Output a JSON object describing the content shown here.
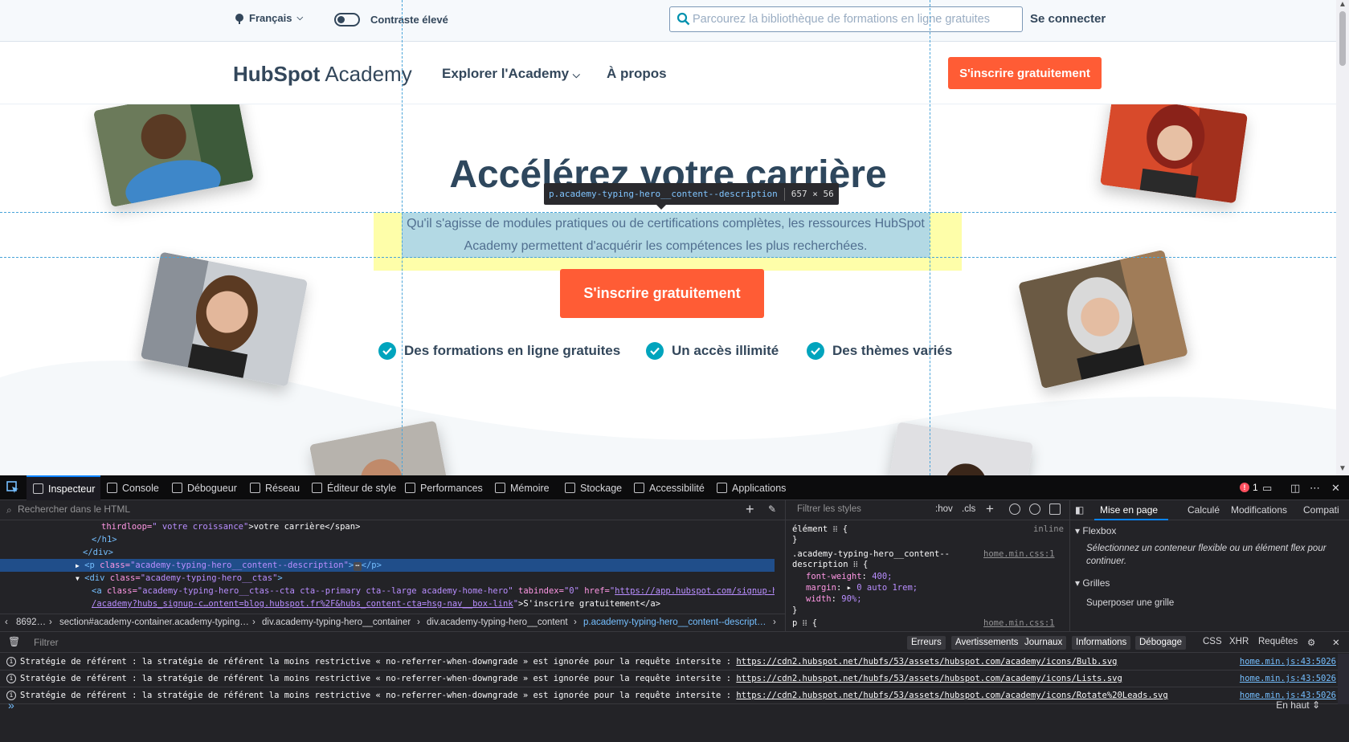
{
  "page": {
    "language": "Français",
    "contrast_label": "Contraste élevé",
    "search_placeholder": "Parcourez la bibliothèque de formations en ligne gratuites",
    "login": "Se connecter",
    "logo_hub": "HubSpot",
    "logo_academy": "Academy",
    "nav": {
      "explore": "Explorer l'Academy",
      "about": "À propos"
    },
    "cta_top": "S'inscrire gratuitement",
    "hero": {
      "title": "Accélérez votre carrière",
      "description": "Qu'il s'agisse de modules pratiques ou de certifications complètes, les ressources HubSpot Academy permettent d'acquérir les compétences les plus recherchées.",
      "cta": "S'inscrire gratuitement",
      "features": [
        "Des formations en ligne gratuites",
        "Un accès illimité",
        "Des thèmes variés"
      ]
    },
    "highlight": {
      "selector": "p.academy-typing-hero__content--description",
      "size": "657 × 56"
    },
    "colors": {
      "accent": "#ff5c35",
      "text": "#33475b",
      "check": "#00a4bd"
    }
  },
  "devtools": {
    "tabs": [
      "Inspecteur",
      "Console",
      "Débogueur",
      "Réseau",
      "Éditeur de style",
      "Performances",
      "Mémoire",
      "Stockage",
      "Accessibilité",
      "Applications"
    ],
    "error_count": "1",
    "search_placeholder": "Rechercher dans le HTML",
    "markup": {
      "l1_attr": "thirdloop=",
      "l1_val": "\" votre croissance\"",
      "l1_text": ">votre carrière</span>",
      "l2": "</h1>",
      "l3": "</div>",
      "l4_open": "<p ",
      "l4_attr": "class=",
      "l4_val": "\"academy-typing-hero__content--description\"",
      "l4_more": "⋯",
      "l4_close": "</p>",
      "l5_open": "<div ",
      "l5_attr": "class=",
      "l5_val": "\"academy-typing-hero__ctas\"",
      "l6_open": "<a ",
      "l6_attr": "class=",
      "l6_val": "\"academy-typing-hero__ctas--cta cta--primary cta--large academy-home-hero\"",
      "l6_tabattr": "tabindex=",
      "l6_tabval": "\"0\"",
      "l6_hrefattr": "href=",
      "l6_href1": "https://app.hubspot.com/signup-hubspot",
      "l6_href2": "/academy?hubs_signup-c…ontent=blog.hubspot.fr%2F&hubs_content-cta=hsg-nav__box-link",
      "l6_text": ">S'inscrire gratuitement</a>"
    },
    "breadcrumbs": [
      "8692…",
      "section#academy-container.academy-typing…",
      "div.academy-typing-hero__container",
      "div.academy-typing-hero__content",
      "p.academy-typing-hero__content--descript…"
    ],
    "rules": {
      "filter_placeholder": "Filtrer les styles",
      "hov": ":hov",
      "cls": ".cls",
      "element": "élément",
      "inline": "inline",
      "selector1": ".academy-typing-hero__content--",
      "selector2": "description",
      "source": "home.min.css:1",
      "props": [
        {
          "name": "font-weight",
          "value": "400;"
        },
        {
          "name": "margin",
          "value": "0 auto 1rem;"
        },
        {
          "name": "width",
          "value": "90%;"
        }
      ],
      "next_selector": "p",
      "next_source": "home.min.css:1"
    },
    "layout": {
      "tabs": [
        "Mise en page",
        "Calculé",
        "Modifications",
        "Compati"
      ],
      "flexbox": "Flexbox",
      "flex_note": "Sélectionnez un conteneur flexible ou un élément flex pour continuer.",
      "grids": "Grilles",
      "overlay": "Superposer une grille"
    },
    "console": {
      "filter_placeholder": "Filtrer",
      "levels": [
        "Erreurs",
        "Avertissements",
        "Journaux",
        "Informations",
        "Débogage"
      ],
      "types": [
        "CSS",
        "XHR",
        "Requêtes"
      ],
      "messages": [
        {
          "text": "Stratégie de référent : la stratégie de référent la moins restrictive « no-referrer-when-downgrade » est ignorée pour la requête intersite : ",
          "url": "https://cdn2.hubspot.net/hubfs/53/assets/hubspot.com/academy/icons/Bulb.svg",
          "source": "home.min.js:43:5026"
        },
        {
          "text": "Stratégie de référent : la stratégie de référent la moins restrictive « no-referrer-when-downgrade » est ignorée pour la requête intersite : ",
          "url": "https://cdn2.hubspot.net/hubfs/53/assets/hubspot.com/academy/icons/Lists.svg",
          "source": "home.min.js:43:5026"
        },
        {
          "text": "Stratégie de référent : la stratégie de référent la moins restrictive « no-referrer-when-downgrade » est ignorée pour la requête intersite : ",
          "url": "https://cdn2.hubspot.net/hubfs/53/assets/hubspot.com/academy/icons/Rotate%20Leads.svg",
          "source": "home.min.js:43:5026"
        }
      ],
      "position": "En haut"
    }
  }
}
